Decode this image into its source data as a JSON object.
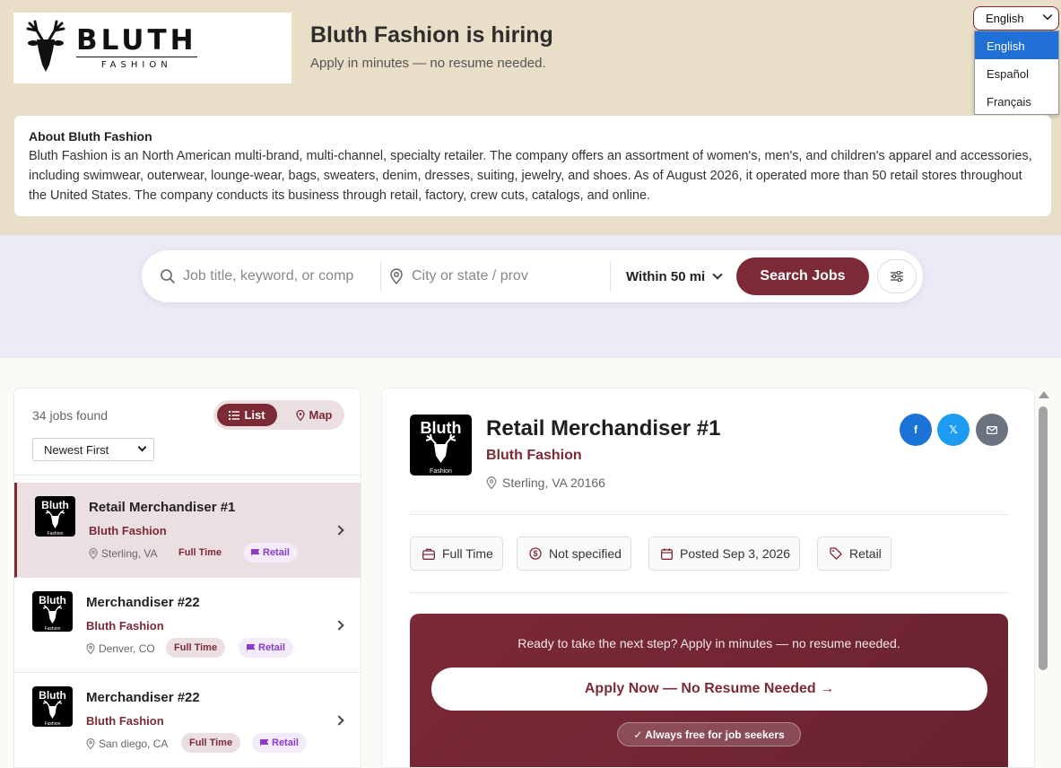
{
  "header": {
    "logo_main": "BLUTH",
    "logo_sub": "FASHION",
    "hiring_title": "Bluth Fashion is hiring",
    "hiring_sub": "Apply in minutes — no resume needed."
  },
  "language": {
    "selected": "English",
    "options": [
      "English",
      "Español",
      "Français"
    ]
  },
  "about": {
    "heading": "About Bluth Fashion",
    "body": "Bluth Fashion is an North American multi-brand, multi-channel, specialty retailer. The company offers an assortment of women's, men's, and children's apparel and accessories, including swimwear, outerwear, lounge-wear, bags, sweaters, denim, dresses, suiting, jewelry, and shoes. As of August 2026, it operated more than 50 retail stores throughout the United States. The company conducts its business through retail, factory, crew cuts, catalogs, and online."
  },
  "search": {
    "keyword_placeholder": "Job title, keyword, or comp",
    "location_placeholder": "City or state / prov",
    "radius": "Within 50 mi",
    "button": "Search Jobs"
  },
  "results": {
    "count_text": "34 jobs found",
    "view_list": "List",
    "view_map": "Map",
    "sort": "Newest First",
    "jobs": [
      {
        "title": "Retail Merchandiser #1",
        "company": "Bluth Fashion",
        "location": "Sterling, VA",
        "type": "Full Time",
        "category": "Retail"
      },
      {
        "title": "Merchandiser #22",
        "company": "Bluth Fashion",
        "location": "Denver, CO",
        "type": "Full Time",
        "category": "Retail"
      },
      {
        "title": "Merchandiser #22",
        "company": "Bluth Fashion",
        "location": "San diego, CA",
        "type": "Full Time",
        "category": "Retail"
      }
    ]
  },
  "detail": {
    "logo_text": "Bluth",
    "logo_small": "Fashion",
    "title": "Retail Merchandiser #1",
    "company": "Bluth Fashion",
    "location": "Sterling, VA 20166",
    "chips": {
      "type": "Full Time",
      "salary": "Not specified",
      "posted": "Posted Sep 3, 2026",
      "category": "Retail"
    },
    "share": {
      "facebook": "f",
      "x": "𝕏"
    },
    "apply_message": "Ready to take the next step? Apply in minutes — no resume needed.",
    "apply_button": "Apply Now — No Resume Needed →",
    "free_badge": "✓ Always free for job seekers"
  },
  "colors": {
    "brand": "#7b2a36",
    "header_bg": "#e9dfc8",
    "search_bg": "#eceaf6",
    "category": "#8a3bc7"
  },
  "icons": {
    "search": "search-icon",
    "location": "pin-icon",
    "filter": "sliders-icon",
    "list": "list-icon",
    "map": "map-pin-icon",
    "briefcase": "briefcase-icon",
    "money": "dollar-icon",
    "calendar": "calendar-icon",
    "tag": "tag-icon",
    "category": "flag-icon",
    "chevron": "chevron-right-icon",
    "mail": "mail-icon"
  }
}
